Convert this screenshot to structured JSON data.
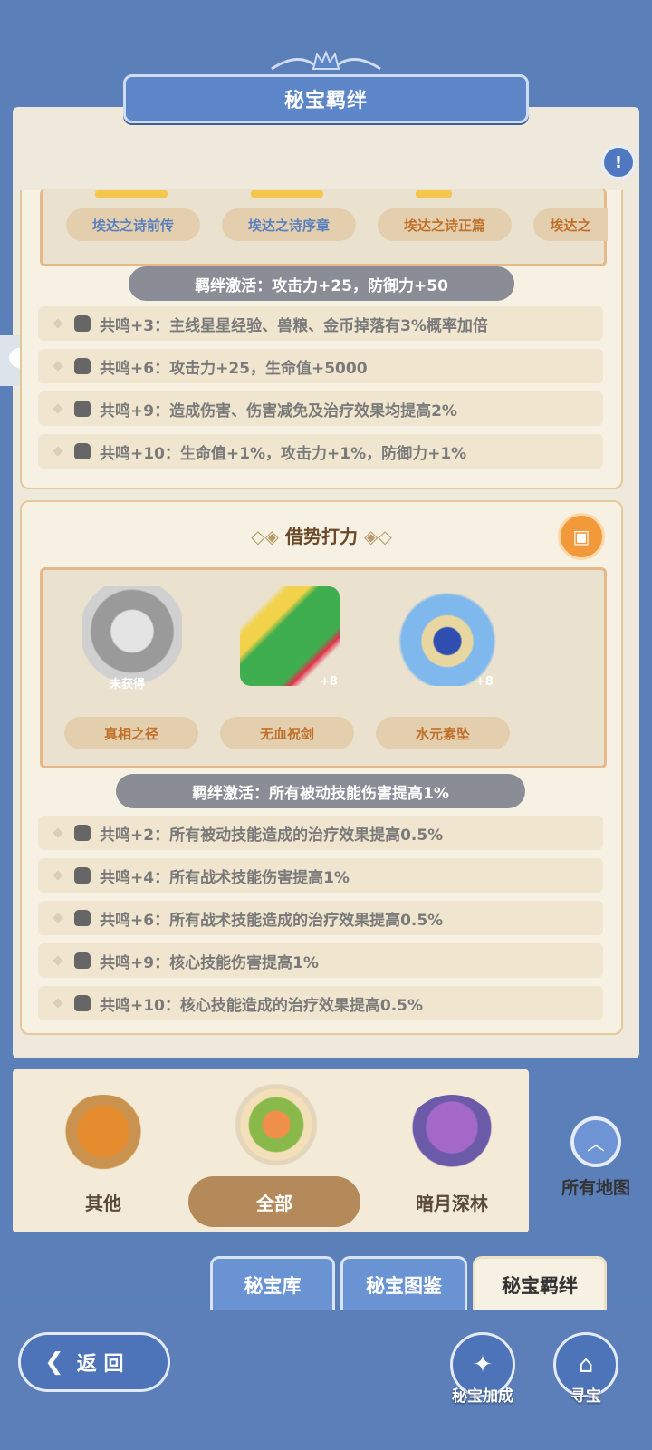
{
  "header": {
    "title": "秘宝羁绊"
  },
  "panel1": {
    "items": [
      "埃达之诗前传",
      "埃达之诗序章",
      "埃达之诗正篇",
      "埃达之"
    ],
    "bond": "羁绊激活：攻击力+25，防御力+50",
    "resonances": [
      "共鸣+3：主线星星经验、兽粮、金币掉落有3%概率加倍",
      "共鸣+6：攻击力+25，生命值+5000",
      "共鸣+9：造成伤害、伤害减免及治疗效果均提高2%",
      "共鸣+10：生命值+1%，攻击力+1%，防御力+1%"
    ]
  },
  "panel2": {
    "title": "借势打力",
    "items": [
      {
        "name": "真相之径",
        "badge": "未获得"
      },
      {
        "name": "无血祝剑",
        "badge": "+8"
      },
      {
        "name": "水元素坠",
        "badge": "+8"
      }
    ],
    "bond": "羁绊激活：所有被动技能伤害提高1%",
    "resonances": [
      "共鸣+2：所有被动技能造成的治疗效果提高0.5%",
      "共鸣+4：所有战术技能伤害提高1%",
      "共鸣+6：所有战术技能造成的治疗效果提高0.5%",
      "共鸣+9：核心技能伤害提高1%",
      "共鸣+10：核心技能造成的治疗效果提高0.5%"
    ]
  },
  "map_filter": {
    "items": [
      "其他",
      "全部",
      "暗月深林"
    ],
    "selected": "全部",
    "all_maps": "所有地图"
  },
  "tabs": [
    "秘宝库",
    "秘宝图鉴",
    "秘宝羁绊"
  ],
  "bottom": {
    "back": "返 回",
    "bonus": "秘宝加成",
    "treasure": "寻宝"
  },
  "icons": {
    "help": "help-book-icon",
    "chat": "chat-bubble-icon",
    "chest": "treasure-chest-icon",
    "up": "chevron-up-icon"
  }
}
